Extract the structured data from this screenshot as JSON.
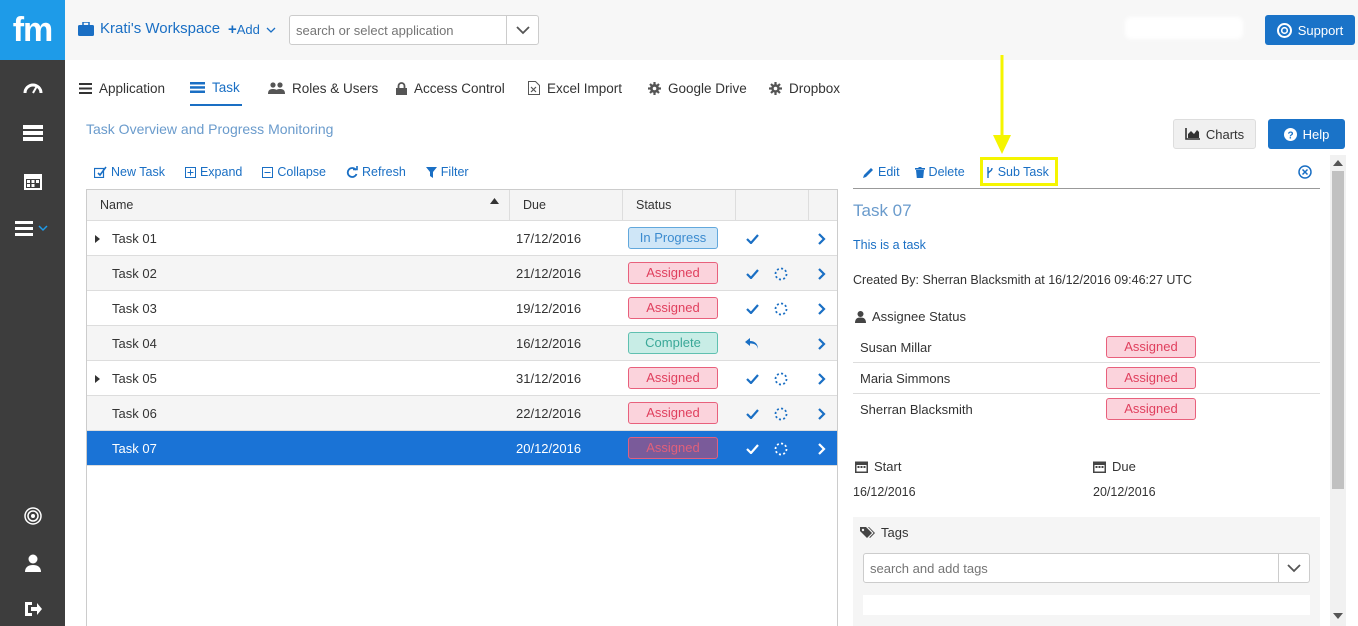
{
  "app": {
    "logo": "fm"
  },
  "header": {
    "workspace": "Krati's Workspace",
    "add_label": "Add",
    "app_search_placeholder": "search or select application",
    "support_label": "Support"
  },
  "tabs": [
    {
      "label": "Application",
      "icon": "list-icon"
    },
    {
      "label": "Task",
      "icon": "task-icon",
      "active": true
    },
    {
      "label": "Roles & Users",
      "icon": "users-icon"
    },
    {
      "label": "Access Control",
      "icon": "lock-icon"
    },
    {
      "label": "Excel Import",
      "icon": "excel-icon"
    },
    {
      "label": "Google Drive",
      "icon": "gear-icon"
    },
    {
      "label": "Dropbox",
      "icon": "gear-icon"
    }
  ],
  "page": {
    "subtitle": "Task Overview and Progress Monitoring",
    "charts_label": "Charts",
    "help_label": "Help"
  },
  "toolbar": {
    "new_task": "New Task",
    "expand": "Expand",
    "collapse": "Collapse",
    "refresh": "Refresh",
    "filter": "Filter"
  },
  "grid": {
    "columns": [
      "Name",
      "Due",
      "Status"
    ],
    "rows": [
      {
        "name": "Task 01",
        "due": "17/12/2016",
        "status": "In Progress",
        "expandable": true
      },
      {
        "name": "Task 02",
        "due": "21/12/2016",
        "status": "Assigned"
      },
      {
        "name": "Task 03",
        "due": "19/12/2016",
        "status": "Assigned"
      },
      {
        "name": "Task 04",
        "due": "16/12/2016",
        "status": "Complete"
      },
      {
        "name": "Task 05",
        "due": "31/12/2016",
        "status": "Assigned",
        "expandable": true
      },
      {
        "name": "Task 06",
        "due": "22/12/2016",
        "status": "Assigned"
      },
      {
        "name": "Task 07",
        "due": "20/12/2016",
        "status": "Assigned",
        "selected": true
      }
    ]
  },
  "detail": {
    "edit": "Edit",
    "delete": "Delete",
    "sub_task": "Sub Task",
    "title": "Task 07",
    "description": "This is a task",
    "created": "Created By: Sherran Blacksmith at 16/12/2016 09:46:27 UTC",
    "assignee_heading": "Assignee Status",
    "assignees": [
      {
        "name": "Susan Millar",
        "status": "Assigned"
      },
      {
        "name": "Maria Simmons",
        "status": "Assigned"
      },
      {
        "name": "Sherran Blacksmith",
        "status": "Assigned"
      }
    ],
    "start_label": "Start",
    "start_value": "16/12/2016",
    "due_label": "Due",
    "due_value": "20/12/2016",
    "tags_label": "Tags",
    "tags_placeholder": "search and add tags"
  },
  "colors": {
    "accent": "#1a73c8",
    "sidebar": "#3d3d3d",
    "logo_bg": "#1e9be8",
    "highlight": "#f5f500"
  }
}
